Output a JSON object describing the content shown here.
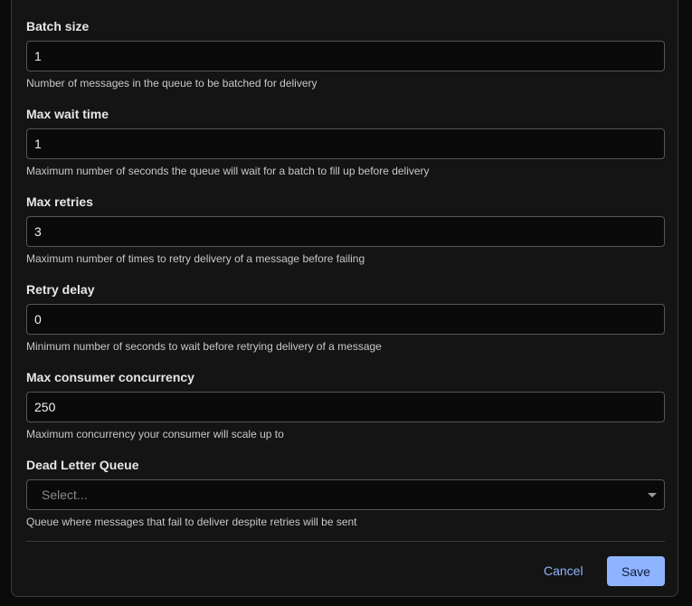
{
  "form": {
    "fields": [
      {
        "label": "Batch size",
        "value": "1",
        "help": "Number of messages in the queue to be batched for delivery"
      },
      {
        "label": "Max wait time",
        "value": "1",
        "help": "Maximum number of seconds the queue will wait for a batch to fill up before delivery"
      },
      {
        "label": "Max retries",
        "value": "3",
        "help": "Maximum number of times to retry delivery of a message before failing"
      },
      {
        "label": "Retry delay",
        "value": "0",
        "help": "Minimum number of seconds to wait before retrying delivery of a message"
      },
      {
        "label": "Max consumer concurrency",
        "value": "250",
        "help": "Maximum concurrency your consumer will scale up to"
      }
    ],
    "dlq": {
      "label": "Dead Letter Queue",
      "placeholder": "Select...",
      "help": "Queue where messages that fail to deliver despite retries will be sent",
      "icon": "chevron-down-icon"
    }
  },
  "actions": {
    "cancel_label": "Cancel",
    "save_label": "Save"
  },
  "colors": {
    "accent": "#8fb4ff",
    "background": "#141414",
    "input_border": "#565656"
  }
}
